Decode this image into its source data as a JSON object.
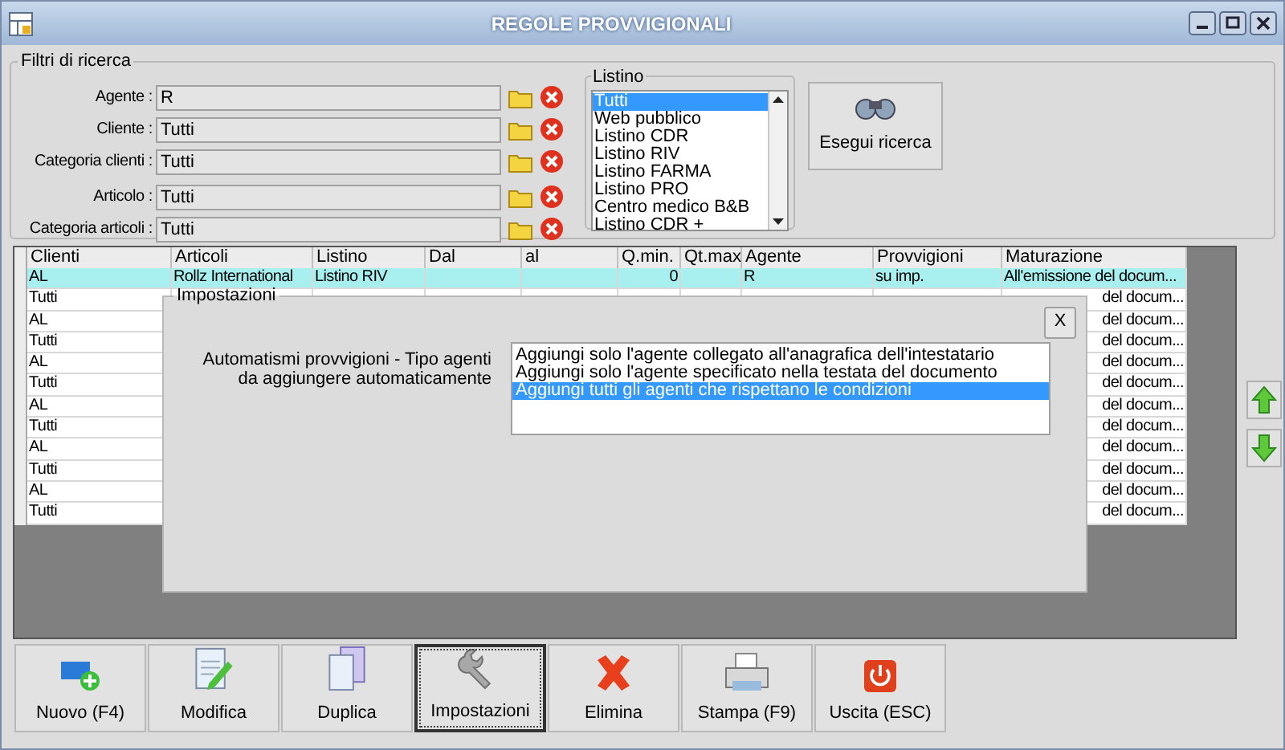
{
  "window": {
    "title": "REGOLE PROVVIGIONALI"
  },
  "filters": {
    "title": "Filtri di ricerca",
    "fields": [
      {
        "label": "Agente :",
        "value": "R"
      },
      {
        "label": "Cliente :",
        "value": "Tutti"
      },
      {
        "label": "Categoria clienti :",
        "value": "Tutti"
      },
      {
        "label": "Articolo :",
        "value": "Tutti"
      },
      {
        "label": "Categoria articoli :",
        "value": "Tutti"
      }
    ]
  },
  "listino": {
    "title": "Listino",
    "items": [
      {
        "label": "Tutti",
        "selected": true
      },
      {
        "label": "Web pubblico",
        "selected": false
      },
      {
        "label": "Listino CDR",
        "selected": false
      },
      {
        "label": "Listino RIV",
        "selected": false
      },
      {
        "label": "Listino FARMA",
        "selected": false
      },
      {
        "label": "Listino PRO",
        "selected": false
      },
      {
        "label": "Centro medico B&B",
        "selected": false
      },
      {
        "label": "Listino CDR +",
        "selected": false
      }
    ]
  },
  "search_button": "Esegui ricerca",
  "table": {
    "columns": [
      "Clienti",
      "Articoli",
      "Listino",
      "Dal",
      "al",
      "Q.min.",
      "Qt.max",
      "Agente",
      "Provvigioni",
      "Maturazione"
    ],
    "rows": [
      {
        "selected": true,
        "cells": [
          "AL",
          "Rollz International",
          "Listino RIV",
          null,
          null,
          "0",
          null,
          "R",
          "su imp.",
          "All'emissione del docum..."
        ]
      },
      {
        "selected": false,
        "cells": [
          "Tutti",
          null,
          null,
          null,
          null,
          null,
          null,
          null,
          null,
          "del docum..."
        ]
      },
      {
        "selected": false,
        "cells": [
          "AL",
          null,
          null,
          null,
          null,
          null,
          null,
          null,
          null,
          "del docum..."
        ]
      },
      {
        "selected": false,
        "cells": [
          "Tutti",
          null,
          null,
          null,
          null,
          null,
          null,
          null,
          null,
          "del docum..."
        ]
      },
      {
        "selected": false,
        "cells": [
          "AL",
          null,
          null,
          null,
          null,
          null,
          null,
          null,
          null,
          "del docum..."
        ]
      },
      {
        "selected": false,
        "cells": [
          "Tutti",
          null,
          null,
          null,
          null,
          null,
          null,
          null,
          null,
          "del docum..."
        ]
      },
      {
        "selected": false,
        "cells": [
          "AL",
          null,
          null,
          null,
          null,
          null,
          null,
          null,
          null,
          "del docum..."
        ]
      },
      {
        "selected": false,
        "cells": [
          "Tutti",
          null,
          null,
          null,
          null,
          null,
          null,
          null,
          null,
          "del docum..."
        ]
      },
      {
        "selected": false,
        "cells": [
          "AL",
          null,
          null,
          null,
          null,
          null,
          null,
          null,
          null,
          "del docum..."
        ]
      },
      {
        "selected": false,
        "cells": [
          "Tutti",
          null,
          null,
          null,
          null,
          null,
          null,
          null,
          null,
          "del docum..."
        ]
      },
      {
        "selected": false,
        "cells": [
          "AL",
          null,
          null,
          null,
          null,
          null,
          null,
          null,
          null,
          "del docum..."
        ]
      },
      {
        "selected": false,
        "cells": [
          "Tutti",
          null,
          null,
          null,
          null,
          null,
          null,
          null,
          null,
          "del docum..."
        ]
      }
    ]
  },
  "dialog": {
    "title": "Impostazioni",
    "close": "X",
    "label": "Automatismi provvigioni - Tipo agenti da aggiungere automaticamente",
    "options": [
      {
        "label": "Aggiungi solo l'agente collegato all'anagrafica dell'intestatario",
        "selected": false
      },
      {
        "label": "Aggiungi solo l'agente specificato nella testata del documento",
        "selected": false
      },
      {
        "label": "Aggiungi tutti gli agenti che rispettano le condizioni",
        "selected": true
      }
    ]
  },
  "toolbar": [
    {
      "label": "Nuovo (F4)",
      "kind": "new",
      "focused": false
    },
    {
      "label": "Modifica",
      "kind": "edit",
      "focused": false
    },
    {
      "label": "Duplica",
      "kind": "duplicate",
      "focused": false
    },
    {
      "label": "Impostazioni",
      "kind": "settings",
      "focused": true
    },
    {
      "label": "Elimina",
      "kind": "delete",
      "focused": false
    },
    {
      "label": "Stampa (F9)",
      "kind": "print",
      "focused": false
    },
    {
      "label": "Uscita (ESC)",
      "kind": "exit",
      "focused": false
    }
  ]
}
